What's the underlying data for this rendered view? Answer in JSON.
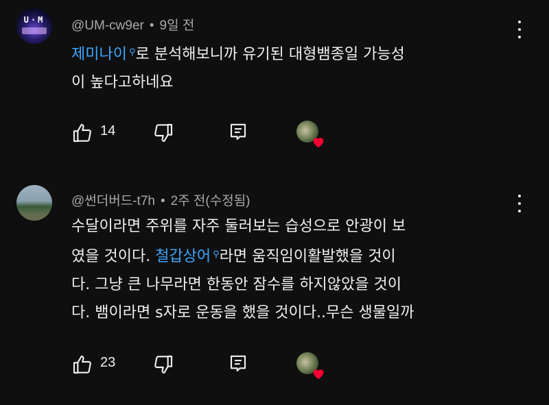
{
  "comments": [
    {
      "author": "@UM-cw9er",
      "time": "9일 전",
      "avatar_text": "U·M",
      "text_link": "제미나이",
      "text_line1_rest": "로 분석해보니까 유기된 대형뱀종일 가능성",
      "text_line2": "이 높다고하네요",
      "likes": "14"
    },
    {
      "author": "@썬더버드-t7h",
      "time": "2주 전(수정됨)",
      "text_line1": "수달이라면 주위를 자주 둘러보는 습성으로 안광이 보",
      "text_line2_pre": "였을 것이다. ",
      "text_link": "철갑상어",
      "text_line2_post": "라면 움직임이활발했을 것이",
      "text_line3": "다. 그냥 큰 나무라면  한동안 잠수를 하지않았을 것이",
      "text_line4": "다. 뱀이라면 s자로 운동을 했을 것이다..무슨 생물일까",
      "likes": "23"
    }
  ],
  "colors": {
    "background": "#0f0f0f",
    "text": "#f1f1f1",
    "meta": "#aaaaaa",
    "link": "#3ea6ff",
    "heart": "#ff0033"
  },
  "icons": [
    "thumbs-up-icon",
    "thumbs-down-icon",
    "reply-icon",
    "creator-heart-icon",
    "more-vert-icon",
    "search-icon"
  ]
}
